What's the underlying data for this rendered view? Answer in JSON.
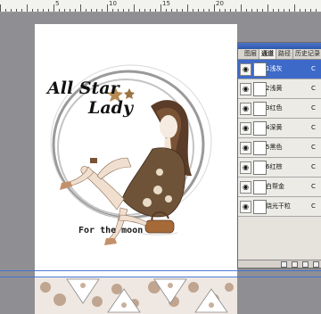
{
  "ruler": {
    "numbers": [
      "5",
      "10",
      "15",
      "20"
    ]
  },
  "artwork": {
    "headline_line1": "All Star",
    "headline_line2": "Lady",
    "tagline": "For the moon"
  },
  "layers_panel": {
    "tabs": [
      {
        "label": "图层"
      },
      {
        "label": "通道"
      },
      {
        "label": "路径"
      },
      {
        "label": "历史记录"
      }
    ],
    "layers": [
      {
        "name": "1浅灰",
        "value": "C"
      },
      {
        "name": "2浅黄",
        "value": "C"
      },
      {
        "name": "3红色",
        "value": "C"
      },
      {
        "name": "4深黄",
        "value": "C"
      },
      {
        "name": "5黑色",
        "value": "C"
      },
      {
        "name": "6红棕",
        "value": "C"
      },
      {
        "name": "白帮金",
        "value": "C"
      },
      {
        "name": "烧光干粒",
        "value": "C"
      }
    ],
    "selected_index": 0
  },
  "colors": {
    "workspace": "#8f8f93",
    "selection": "#3d69c9",
    "guide": "#3a6fd8"
  }
}
